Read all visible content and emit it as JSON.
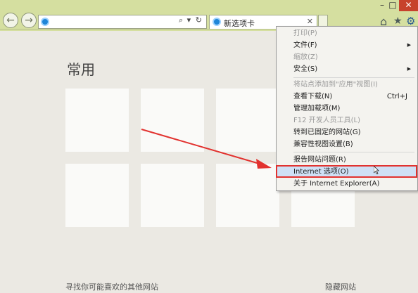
{
  "window": {
    "minimize": "–",
    "maximize": "□"
  },
  "address_bar": {
    "value": "",
    "search_glyph": "⌕",
    "dropdown_glyph": "▾",
    "refresh_glyph": "↻"
  },
  "tab": {
    "title": "新选项卡",
    "close": "✕"
  },
  "toolbar": {
    "home_glyph": "⌂",
    "favorites_glyph": "★",
    "tools_glyph": "⚙"
  },
  "page": {
    "heading": "常用",
    "footer_left": "寻找你可能喜欢的其他网站",
    "footer_right": "隐藏网站"
  },
  "menu": {
    "items": [
      {
        "label": "打印(P)",
        "enabled": false,
        "shortcut": "",
        "submenu": false
      },
      {
        "label": "文件(F)",
        "enabled": true,
        "shortcut": "",
        "submenu": true
      },
      {
        "label": "缩放(Z)",
        "enabled": false,
        "shortcut": "",
        "submenu": false
      },
      {
        "label": "安全(S)",
        "enabled": true,
        "shortcut": "",
        "submenu": true
      },
      {
        "label": "将站点添加到\"应用\"视图(I)",
        "enabled": false,
        "shortcut": "",
        "submenu": false
      },
      {
        "label": "查看下载(N)",
        "enabled": true,
        "shortcut": "Ctrl+J",
        "submenu": false
      },
      {
        "label": "管理加载项(M)",
        "enabled": true,
        "shortcut": "",
        "submenu": false
      },
      {
        "label": "F12 开发人员工具(L)",
        "enabled": false,
        "shortcut": "",
        "submenu": false
      },
      {
        "label": "转到已固定的网站(G)",
        "enabled": true,
        "shortcut": "",
        "submenu": false
      },
      {
        "label": "兼容性视图设置(B)",
        "enabled": true,
        "shortcut": "",
        "submenu": false
      },
      {
        "label": "报告网站问题(R)",
        "enabled": true,
        "shortcut": "",
        "submenu": false
      },
      {
        "label": "Internet 选项(O)",
        "enabled": true,
        "shortcut": "",
        "submenu": false,
        "highlighted": true
      },
      {
        "label": "关于 Internet Explorer(A)",
        "enabled": true,
        "shortcut": "",
        "submenu": false
      }
    ],
    "submenu_glyph": "▶"
  },
  "colors": {
    "toolbar": "#d5dfa0",
    "page_bg": "#ebe9e3",
    "tile": "#fafaf8",
    "highlight_border": "#e2322f",
    "arrow": "#e2322f"
  }
}
